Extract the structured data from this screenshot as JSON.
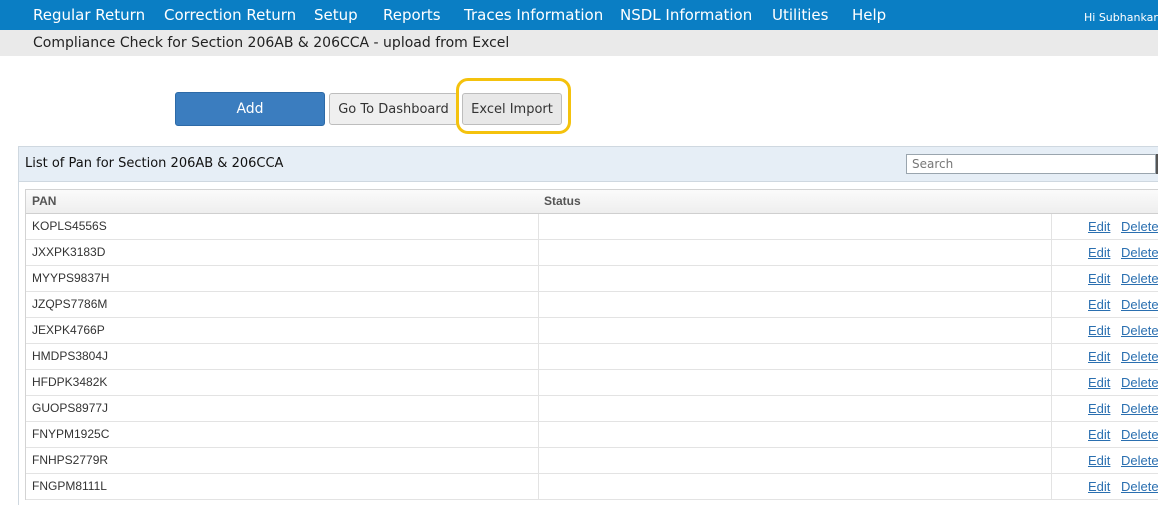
{
  "nav": {
    "items": [
      "Regular Return",
      "Correction Return",
      "Setup",
      "Reports",
      "Traces Information",
      "NSDL Information",
      "Utilities",
      "Help"
    ],
    "user": "Hi Subhankar"
  },
  "subheader": {
    "title": "Compliance Check for Section 206AB & 206CCA - upload from Excel"
  },
  "buttons": {
    "add": "Add",
    "dashboard": "Go To Dashboard",
    "excel_import": "Excel Import"
  },
  "panel": {
    "title": "List of Pan for Section 206AB & 206CCA",
    "search_placeholder": "Search"
  },
  "table": {
    "headers": {
      "pan": "PAN",
      "status": "Status"
    },
    "edit_label": "Edit",
    "delete_label": "Delete",
    "rows": [
      {
        "pan": "KOPLS4556S",
        "status": ""
      },
      {
        "pan": "JXXPK3183D",
        "status": ""
      },
      {
        "pan": "MYYPS9837H",
        "status": ""
      },
      {
        "pan": "JZQPS7786M",
        "status": ""
      },
      {
        "pan": "JEXPK4766P",
        "status": ""
      },
      {
        "pan": "HMDPS3804J",
        "status": ""
      },
      {
        "pan": "HFDPK3482K",
        "status": ""
      },
      {
        "pan": "GUOPS8977J",
        "status": ""
      },
      {
        "pan": "FNYPM1925C",
        "status": ""
      },
      {
        "pan": "FNHPS2779R",
        "status": ""
      },
      {
        "pan": "FNGPM8111L",
        "status": ""
      }
    ]
  },
  "colors": {
    "nav_bg": "#0a7ec4",
    "primary_button": "#3b7dbf",
    "highlight": "#f4c20d",
    "link": "#2a6fb0"
  }
}
